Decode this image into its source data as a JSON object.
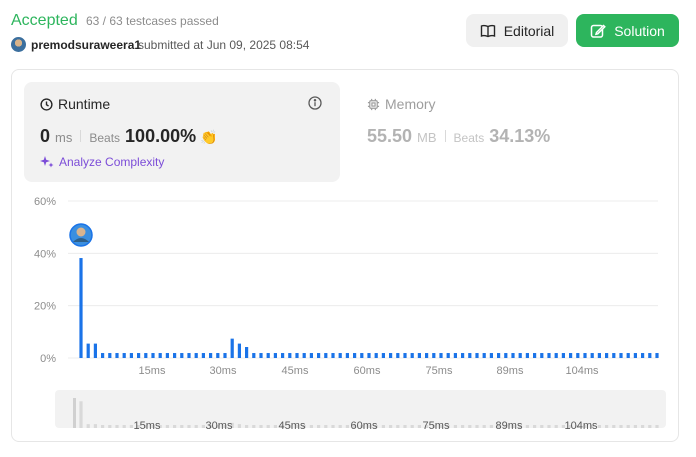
{
  "header": {
    "status": "Accepted",
    "cases": "63 / 63 testcases passed",
    "user": "premodsuraweera1",
    "submitted": "submitted at Jun 09, 2025 08:54",
    "editorial_label": "Editorial",
    "solution_label": "Solution"
  },
  "runtime": {
    "title": "Runtime",
    "value": "0",
    "unit": "ms",
    "beats_label": "Beats",
    "beats": "100.00%",
    "analyze_label": "Analyze Complexity"
  },
  "memory": {
    "title": "Memory",
    "value": "55.50",
    "unit": "MB",
    "beats_label": "Beats",
    "beats": "34.13%"
  },
  "colors": {
    "accepted": "#2db55d",
    "bar": "#1a73e8",
    "brush_bar": "#d9d9d9",
    "analyze": "#7c4dd8"
  },
  "chart_data": {
    "type": "bar",
    "xlabel": "",
    "ylabel": "",
    "ylim": [
      0,
      60
    ],
    "y_ticks": [
      "0%",
      "20%",
      "40%",
      "60%"
    ],
    "x_ticks": [
      "15ms",
      "30ms",
      "45ms",
      "60ms",
      "75ms",
      "89ms",
      "104ms"
    ],
    "grid": true,
    "highlighted_index": 0,
    "values": [
      38.2,
      5.5,
      5.5,
      1.9,
      1.9,
      1.9,
      1.9,
      1.9,
      1.9,
      1.9,
      1.9,
      1.9,
      1.9,
      1.9,
      1.9,
      1.9,
      1.9,
      1.9,
      1.9,
      1.9,
      1.9,
      7.4,
      5.5,
      4.2,
      1.9,
      1.9,
      1.9,
      1.9,
      1.9,
      1.9,
      1.9,
      1.9,
      1.9,
      1.9,
      1.9,
      1.9,
      1.9,
      1.9,
      1.9,
      1.9,
      1.9,
      1.9,
      1.9,
      1.9,
      1.9,
      1.9,
      1.9,
      1.9,
      1.9,
      1.9,
      1.9,
      1.9,
      1.9,
      1.9,
      1.9,
      1.9,
      1.9,
      1.9,
      1.9,
      1.9,
      1.9,
      1.9,
      1.9,
      1.9,
      1.9,
      1.9,
      1.9,
      1.9,
      1.9,
      1.9,
      1.9,
      1.9,
      1.9,
      1.9,
      1.9,
      1.9,
      1.9,
      1.9,
      1.9,
      1.9,
      1.9
    ]
  }
}
